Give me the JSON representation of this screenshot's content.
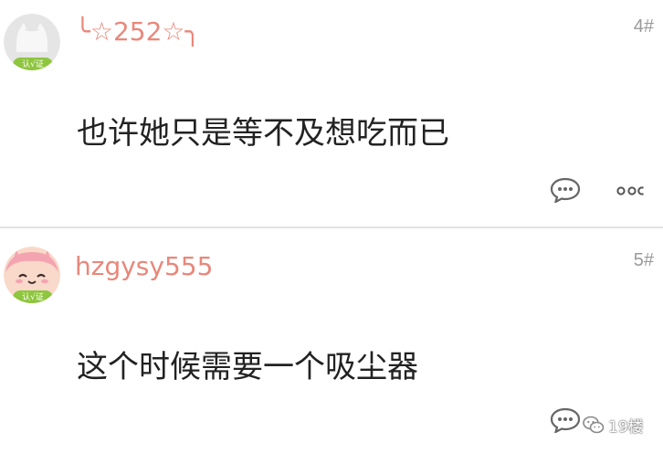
{
  "posts": [
    {
      "username": "╰☆252☆╮",
      "floor": "4#",
      "content": "也许她只是等不及想吃而已",
      "badge": "认√证"
    },
    {
      "username": "hzgysy555",
      "floor": "5#",
      "content": "这个时候需要一个吸尘器",
      "badge": "认√证"
    }
  ],
  "watermark": {
    "label": "19楼"
  },
  "icons": {
    "comment": "comment-bubble-icon",
    "more": "more-dots-icon",
    "wechat": "wechat-logo-icon"
  },
  "colors": {
    "username": "#e9877a",
    "verify_badge": "#8ec63f",
    "floor": "#9a9a9a",
    "divider": "#e3e3e3"
  }
}
